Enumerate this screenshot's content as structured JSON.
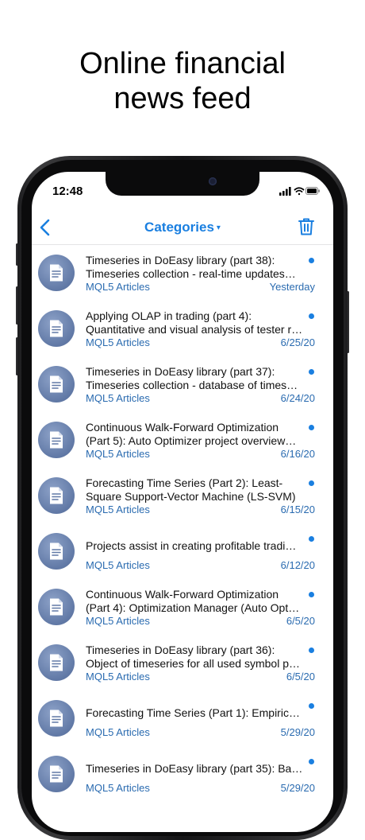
{
  "headline": [
    "Online financial",
    "news feed"
  ],
  "status": {
    "time": "12:48"
  },
  "nav": {
    "title": "Categories",
    "caret": "▾"
  },
  "feed": [
    {
      "lines": [
        "Timeseries in DoEasy library (part 38):",
        "Timeseries collection - real-time updates…"
      ],
      "source": "MQL5 Articles",
      "date": "Yesterday"
    },
    {
      "lines": [
        "Applying OLAP in trading (part 4):",
        "Quantitative and visual analysis of tester r…"
      ],
      "source": "MQL5 Articles",
      "date": "6/25/20"
    },
    {
      "lines": [
        "Timeseries in DoEasy library (part 37):",
        "Timeseries collection - database of times…"
      ],
      "source": "MQL5 Articles",
      "date": "6/24/20"
    },
    {
      "lines": [
        "Continuous Walk-Forward Optimization",
        "(Part 5): Auto Optimizer project overview…"
      ],
      "source": "MQL5 Articles",
      "date": "6/16/20"
    },
    {
      "lines": [
        "Forecasting Time Series (Part 2): Least-",
        "Square Support-Vector Machine (LS-SVM)"
      ],
      "source": "MQL5 Articles",
      "date": "6/15/20"
    },
    {
      "lines": [
        "Projects assist in creating profitable tradi…"
      ],
      "source": "MQL5 Articles",
      "date": "6/12/20"
    },
    {
      "lines": [
        "Continuous Walk-Forward Optimization",
        "(Part 4): Optimization Manager (Auto Opt…"
      ],
      "source": "MQL5 Articles",
      "date": "6/5/20"
    },
    {
      "lines": [
        "Timeseries in DoEasy library (part 36):",
        "Object of timeseries for all used symbol p…"
      ],
      "source": "MQL5 Articles",
      "date": "6/5/20"
    },
    {
      "lines": [
        "Forecasting Time Series (Part 1): Empiric…"
      ],
      "source": "MQL5 Articles",
      "date": "5/29/20"
    },
    {
      "lines": [
        "Timeseries in DoEasy library (part 35): Ba…"
      ],
      "source": "MQL5 Articles",
      "date": "5/29/20"
    }
  ],
  "icons": {
    "back": "chevron-left-icon",
    "trash": "trash-icon",
    "article": "document-icon",
    "unread": "unread-dot-icon",
    "signal": "cellular-signal-icon",
    "wifi": "wifi-icon",
    "battery": "battery-icon"
  },
  "colors": {
    "accent": "#1a7fe0",
    "source_text": "#2a6bb0",
    "avatar": "#6179a6"
  }
}
